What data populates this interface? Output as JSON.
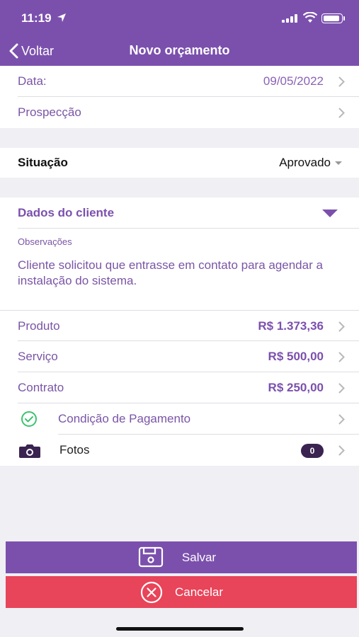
{
  "status_bar": {
    "time": "11:19"
  },
  "nav": {
    "back_label": "Voltar",
    "title": "Novo orçamento"
  },
  "rows": {
    "data": {
      "label": "Data:",
      "value": "09/05/2022"
    },
    "prospeccao": {
      "label": "Prospecção"
    }
  },
  "situacao": {
    "label": "Situação",
    "value": "Aprovado"
  },
  "cliente": {
    "title": "Dados do cliente",
    "obs_label": "Observações",
    "obs_text": "Cliente solicitou que entrasse em contato para agendar a instalação do sistema."
  },
  "valores": {
    "produto": {
      "label": "Produto",
      "value": "R$ 1.373,36"
    },
    "servico": {
      "label": "Serviço",
      "value": "R$ 500,00"
    },
    "contrato": {
      "label": "Contrato",
      "value": "R$ 250,00"
    }
  },
  "pagamento": {
    "label": "Condição de Pagamento"
  },
  "fotos": {
    "label": "Fotos",
    "count": "0"
  },
  "actions": {
    "save_label": "Salvar",
    "cancel_label": "Cancelar"
  },
  "colors": {
    "primary": "#7b50ad",
    "danger": "#e8445a",
    "success": "#3cc36e"
  },
  "icons": {
    "back": "chevron-left-icon",
    "row": "chevron-right-icon",
    "save": "save-icon",
    "cancel": "close-circle-icon",
    "condition": "check-circle-icon",
    "photos": "camera-icon"
  }
}
